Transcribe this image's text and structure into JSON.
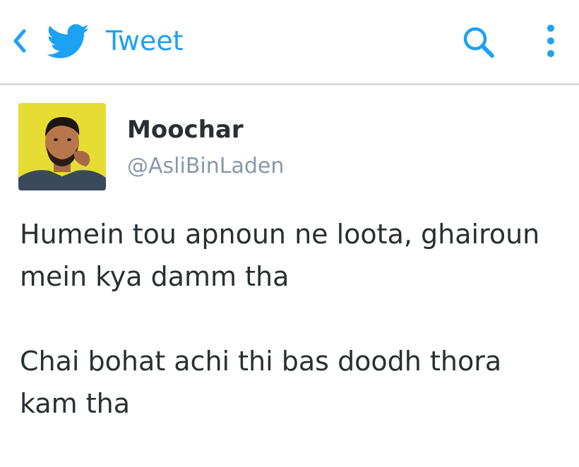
{
  "colors": {
    "accent": "#1da1f2",
    "text": "#292f33",
    "muted": "#8899a6",
    "avatar_bg": "#e6dc33"
  },
  "header": {
    "title": "Tweet",
    "icons": [
      "chevron-left-icon",
      "twitter-bird-icon",
      "search-icon",
      "more-vertical-icon"
    ]
  },
  "tweet": {
    "author_name": "Moochar",
    "author_handle": "@AsliBinLaden",
    "paragraphs": [
      "Humein tou apnoun ne loota, ghairoun\nmein kya damm tha",
      "Chai bohat achi thi bas doodh thora\nkam tha"
    ]
  }
}
